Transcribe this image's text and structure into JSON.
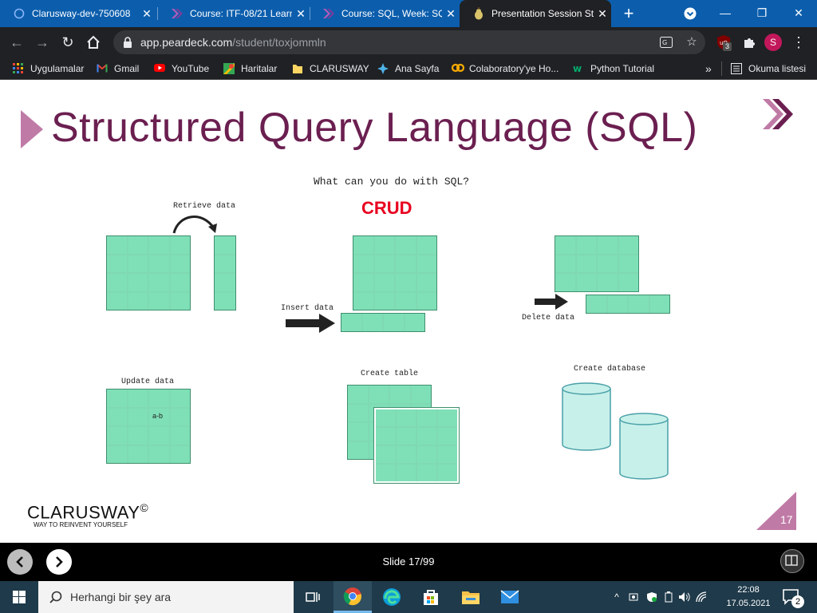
{
  "browser": {
    "tabs": [
      {
        "title": "Clarusway-dev-750608",
        "icon": "circle-ring-icon",
        "active": false
      },
      {
        "title": "Course: ITF-08/21 Learn",
        "icon": "clarusway-chevron-icon",
        "active": false
      },
      {
        "title": "Course: SQL, Week: SQL",
        "icon": "clarusway-chevron-icon",
        "active": false
      },
      {
        "title": "Presentation Session Stu",
        "icon": "peardeck-icon",
        "active": true
      }
    ],
    "new_tab": "+",
    "url_domain": "app.peardeck.com",
    "url_path": "/student/toxjommln",
    "extension_badge": "3",
    "profile_initial": "S",
    "bookmarks": [
      {
        "label": "Uygulamalar",
        "icon": "apps-grid-icon"
      },
      {
        "label": "Gmail",
        "icon": "gmail-icon"
      },
      {
        "label": "YouTube",
        "icon": "youtube-icon"
      },
      {
        "label": "Haritalar",
        "icon": "maps-icon"
      },
      {
        "label": "CLARUSWAY",
        "icon": "folder-icon"
      },
      {
        "label": "Ana Sayfa",
        "icon": "splash-icon"
      },
      {
        "label": "Colaboratory'ye Ho...",
        "icon": "colab-icon"
      },
      {
        "label": "Python Tutorial",
        "icon": "w3-icon"
      }
    ],
    "more_bookmarks": "»",
    "reading_list": "Okuma listesi"
  },
  "slide": {
    "title": "Structured Query Language (SQL)",
    "question": "What can you do with SQL?",
    "crud": "CRUD",
    "labels": {
      "retrieve": "Retrieve data",
      "insert": "Insert data",
      "delete": "Delete data",
      "update": "Update data",
      "update_cell": "a-b",
      "create_table": "Create table",
      "create_database": "Create database"
    },
    "brand": "CLARUSWAY",
    "brand_mark": "©",
    "tagline": "WAY TO REINVENT YOURSELF",
    "page_number": "17"
  },
  "presenter": {
    "slide_counter": "Slide 17/99"
  },
  "taskbar": {
    "search_placeholder": "Herhangi bir şey ara",
    "time": "22:08",
    "date": "17.05.2021",
    "notification_count": "2"
  },
  "colors": {
    "tab_strip": "#0c5ead",
    "chrome_dark": "#202124",
    "title": "#6b1f50",
    "crud": "#e8001f",
    "table_green": "#7fe0b8",
    "db_cyan": "#c7f0ea",
    "accent_purple": "#c07aa6"
  }
}
